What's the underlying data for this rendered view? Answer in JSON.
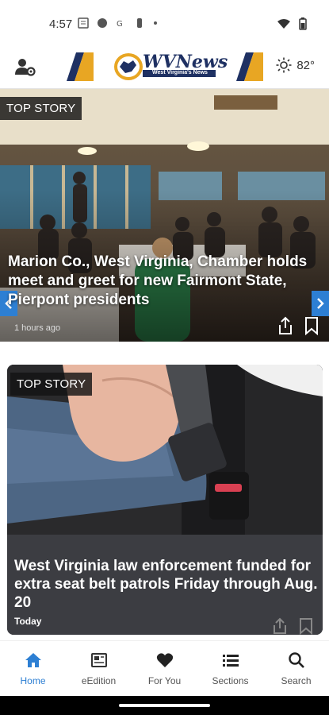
{
  "status_bar": {
    "time": "4:57",
    "left_icons": [
      "sim-card-icon",
      "record-icon",
      "translate-icon",
      "usb-icon",
      "dot-icon"
    ],
    "right_icons": [
      "wifi-icon",
      "battery-icon"
    ]
  },
  "header": {
    "logo_text": "WVNews",
    "logo_subtext": "West Virginia's News",
    "weather_temp": "82°",
    "icons": [
      "account-settings-icon",
      "sun-icon"
    ]
  },
  "hero_story": {
    "tag": "TOP STORY",
    "title": "Marion Co., West Virginia, Chamber holds meet and greet for new Fairmont State, Pierpont presidents",
    "time": "1 hours ago",
    "icons": [
      "share-icon",
      "bookmark-icon",
      "chevron-left-icon",
      "chevron-right-icon"
    ]
  },
  "card_story": {
    "tag": "TOP STORY",
    "title": "West Virginia law enforcement funded for extra seat belt patrols Friday through Aug. 20",
    "time": "Today",
    "icons": [
      "share-icon",
      "bookmark-icon"
    ]
  },
  "bottom_nav": {
    "items": [
      {
        "label": "Home",
        "icon": "home-icon",
        "active": true
      },
      {
        "label": "eEdition",
        "icon": "newspaper-icon",
        "active": false
      },
      {
        "label": "For You",
        "icon": "heart-icon",
        "active": false
      },
      {
        "label": "Sections",
        "icon": "list-icon",
        "active": false
      },
      {
        "label": "Search",
        "icon": "search-icon",
        "active": false
      }
    ]
  },
  "colors": {
    "accent": "#2d7fd3",
    "logo_gold": "#e8a623",
    "logo_navy": "#1f3163",
    "card_bg": "#3c3d42"
  }
}
